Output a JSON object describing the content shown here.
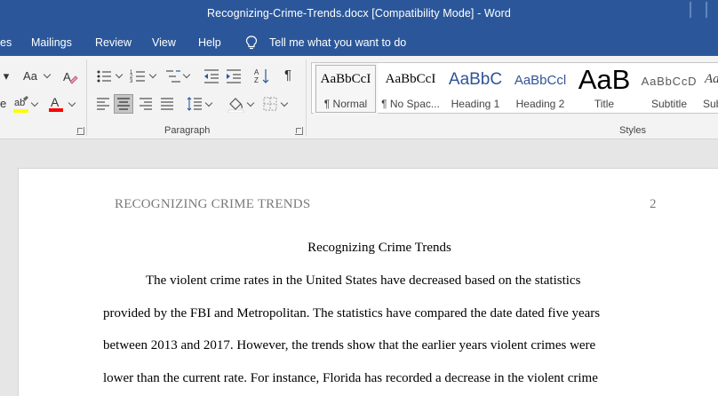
{
  "window": {
    "title": "Recognizing-Crime-Trends.docx [Compatibility Mode]  -  Word"
  },
  "menu": {
    "tabs": [
      "es",
      "Mailings",
      "Review",
      "View",
      "Help"
    ],
    "tell_me": "Tell me what you want to do"
  },
  "ribbon": {
    "font_group": {
      "font_size_label": "Aa"
    },
    "paragraph": {
      "label": "Paragraph"
    },
    "styles": {
      "label": "Styles",
      "items": [
        {
          "preview": "AaBbCcI",
          "name": "¶ Normal"
        },
        {
          "preview": "AaBbCcI",
          "name": "¶ No Spac..."
        },
        {
          "preview": "AaBbC",
          "name": "Heading 1"
        },
        {
          "preview": "AaBbCcl",
          "name": "Heading 2"
        },
        {
          "preview": "AaB",
          "name": "Title"
        },
        {
          "preview": "AaBbCcD",
          "name": "Subtitle"
        },
        {
          "preview": "Aa",
          "name": "Sub"
        }
      ]
    },
    "colors": {
      "highlight": "#ffff00",
      "font_color": "#ff0000",
      "accent": "#2b579a"
    }
  },
  "document": {
    "header_title": "RECOGNIZING CRIME TRENDS",
    "page_number": "2",
    "title": "Recognizing Crime Trends",
    "lines": [
      "The violent crime rates in the United States have decreased based on the statistics",
      "provided by the FBI and Metropolitan. The statistics have compared the date dated five years",
      "between 2013 and 2017. However, the trends show that the earlier years violent crimes were",
      "lower than the current rate. For instance, Florida has recorded a decrease in the violent crime"
    ]
  }
}
